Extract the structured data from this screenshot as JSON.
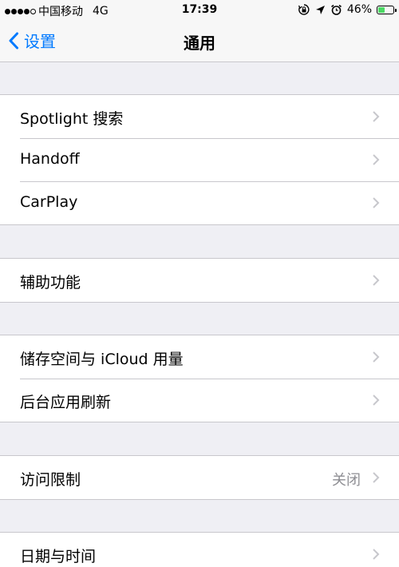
{
  "status_bar": {
    "carrier": "中国移动",
    "network": "4G",
    "time": "17:39",
    "battery_percent": "46%",
    "battery_level": 0.46,
    "battery_color": "#4cd964",
    "signal_dots_filled": 4,
    "signal_dots_total": 5,
    "icons": [
      "screen-rotation-lock-icon",
      "location-arrow-icon",
      "alarm-clock-icon"
    ]
  },
  "nav": {
    "back_label": "设置",
    "title": "通用",
    "accent_color": "#007aff"
  },
  "groups": [
    {
      "items": [
        {
          "label": "Spotlight 搜索"
        },
        {
          "label": "Handoff"
        },
        {
          "label": "CarPlay"
        }
      ]
    },
    {
      "items": [
        {
          "label": "辅助功能"
        }
      ]
    },
    {
      "items": [
        {
          "label": "储存空间与 iCloud 用量"
        },
        {
          "label": "后台应用刷新"
        }
      ]
    },
    {
      "items": [
        {
          "label": "访问限制",
          "value": "关闭"
        }
      ]
    },
    {
      "items": [
        {
          "label": "日期与时间"
        }
      ]
    }
  ]
}
